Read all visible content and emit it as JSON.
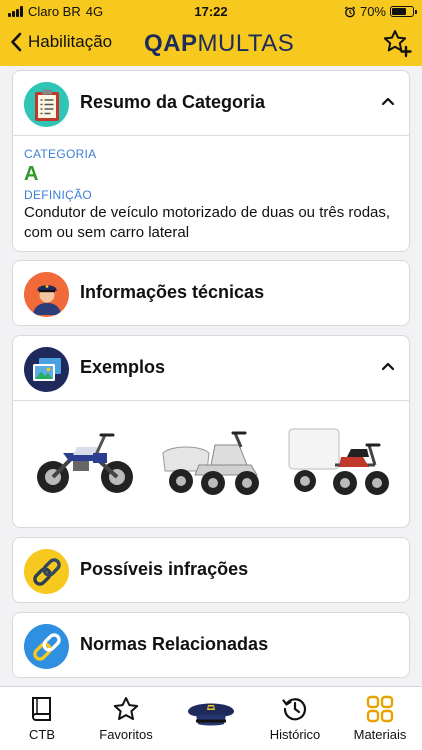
{
  "status": {
    "carrier": "Claro BR",
    "network": "4G",
    "time": "17:22",
    "battery": "70%",
    "battery_level": 0.7
  },
  "nav": {
    "back_label": "Habilitação",
    "logo_bold": "QAP",
    "logo_light": "MULTAS",
    "action_icon": "star-add-icon"
  },
  "summary": {
    "title": "Resumo da Categoria",
    "category_label": "CATEGORIA",
    "category_value": "A",
    "definition_label": "DEFINIÇÃO",
    "definition_text": "Condutor de veículo motorizado de duas ou três rodas, com ou sem carro lateral"
  },
  "sections": {
    "tech": {
      "title": "Informações técnicas",
      "icon": "officer-icon"
    },
    "examples": {
      "title": "Exemplos",
      "icon": "gallery-icon",
      "images": [
        "motorcycle-image",
        "sidecar-image",
        "cargo-tricycle-image"
      ]
    },
    "infractions": {
      "title": "Possíveis infrações",
      "icon": "chain-link-icon"
    },
    "norms": {
      "title": "Normas Relacionadas",
      "icon": "chain-link-icon"
    }
  },
  "tabs": [
    {
      "label": "CTB",
      "icon": "book-icon"
    },
    {
      "label": "Favoritos",
      "icon": "star-icon"
    },
    {
      "label": "",
      "icon": "police-cap-icon"
    },
    {
      "label": "Histórico",
      "icon": "history-icon"
    },
    {
      "label": "Materiais",
      "icon": "grid-icon"
    }
  ],
  "colors": {
    "brand_yellow": "#f7c81e",
    "category_blue": "#3a7fd6",
    "category_green": "#2e9a28",
    "navy": "#1c2c5b"
  }
}
